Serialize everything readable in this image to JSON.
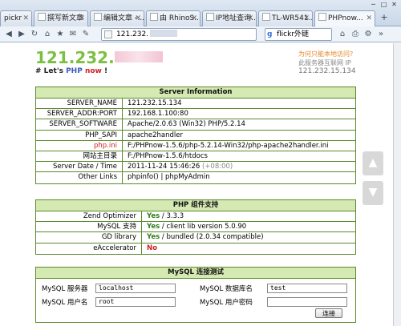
{
  "browser": {
    "tabs": [
      {
        "label": "pickr"
      },
      {
        "label": "撰写新文章"
      },
      {
        "label": "编辑文章 ‹..."
      },
      {
        "label": "由 RhinoS..."
      },
      {
        "label": "IP地址查询..."
      },
      {
        "label": "TL-WR541..."
      },
      {
        "label": "PHPnow..."
      }
    ],
    "url": "121.232.",
    "search_placeholder": "flickr外链"
  },
  "header": {
    "logo_ip": "121.232.",
    "logo_dot": ".",
    "slogan_prefix": "# Let's ",
    "slogan_php": "PHP",
    "slogan_now": "now",
    "slogan_suffix": " !",
    "why_link": "为何只能本地访问?",
    "internet_ip_label": "此服务器互联网 IP",
    "internet_ip": "121.232.15.134"
  },
  "server_info": {
    "title": "Server Information",
    "rows": [
      {
        "label": "SERVER_NAME",
        "value": "121.232.15.134"
      },
      {
        "label": "SERVER_ADDR:PORT",
        "value": "192.168.1.100:80"
      },
      {
        "label": "SERVER_SOFTWARE",
        "value": "Apache/2.0.63 (Win32) PHP/5.2.14"
      },
      {
        "label": "PHP_SAPI",
        "value": "apache2handler"
      },
      {
        "label": "php.ini",
        "value": "F:/PHPnow-1.5.6/php-5.2.14-Win32/php-apache2handler.ini"
      },
      {
        "label": "网站主目录",
        "value": "F:/PHPnow-1.5.6/htdocs"
      },
      {
        "label": "Server Date / Time",
        "value": "2011-11-24 15:46:26",
        "extra": "(+08:00)"
      },
      {
        "label": "Other Links",
        "value": "phpinfo() | phpMyAdmin"
      }
    ]
  },
  "php_support": {
    "title": "PHP 组件支持",
    "rows": [
      {
        "label": "Zend Optimizer",
        "status": "Yes",
        "detail": " / 3.3.3"
      },
      {
        "label": "MySQL 支持",
        "status": "Yes",
        "detail": " / client lib version 5.0.90"
      },
      {
        "label": "GD library",
        "status": "Yes",
        "detail": " / bundled (2.0.34 compatible)"
      },
      {
        "label": "eAccelerator",
        "status": "No",
        "detail": ""
      }
    ]
  },
  "mysql_test": {
    "title": "MySQL 连接测试",
    "server_label": "MySQL 服务器",
    "server_value": "localhost",
    "dbname_label": "MySQL 数据库名",
    "dbname_value": "test",
    "user_label": "MySQL 用户名",
    "user_value": "root",
    "password_label": "MySQL 用户密码",
    "password_value": "",
    "connect_label": "连接"
  },
  "colors": {
    "accent_green": "#7bc043",
    "header_green": "#d5e9b2",
    "border_green": "#5a8a2a",
    "red": "#d02222"
  }
}
